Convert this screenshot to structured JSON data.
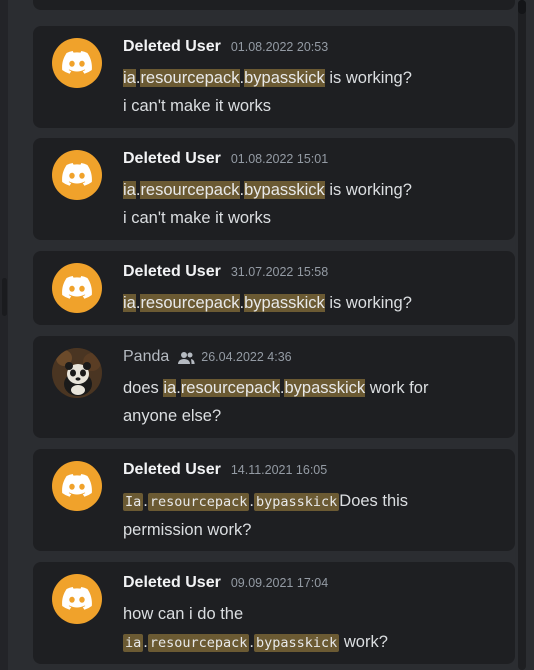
{
  "messages": [
    {
      "author": "Deleted User",
      "timestamp": "01.08.2022 20:53",
      "line1": {
        "p1": "ia",
        "p2": "resourcepack",
        "p3": "bypasskick",
        "rest": " is working?"
      },
      "line2": "i can't make it works"
    },
    {
      "author": "Deleted User",
      "timestamp": "01.08.2022 15:01",
      "line1": {
        "p1": "ia",
        "p2": "resourcepack",
        "p3": "bypasskick",
        "rest": " is working?"
      },
      "line2": "i can't make it works"
    },
    {
      "author": "Deleted User",
      "timestamp": "31.07.2022 15:58",
      "line1": {
        "p1": "ia",
        "p2": "resourcepack",
        "p3": "bypasskick",
        "rest": " is working?"
      }
    },
    {
      "author": "Panda",
      "timestamp": "26.04.2022 4:36",
      "line1": {
        "pre": "does ",
        "p1": "ia",
        "p2": "resourcepack",
        "p3": "bypasskick",
        "rest": " work for"
      },
      "line2": "anyone else?"
    },
    {
      "author": "Deleted User",
      "timestamp": "14.11.2021 16:05",
      "line1": {
        "p1": "Ia",
        "p2": "resourcepack",
        "p3": "bypasskick",
        "rest": "Does this"
      },
      "line2": "permission work?"
    },
    {
      "author": "Deleted User",
      "timestamp": "09.09.2021 17:04",
      "line1": "how can i do the",
      "line2": {
        "p1": "ia",
        "p2": "resourcepack",
        "p3": "bypasskick",
        "rest": " work?"
      }
    }
  ]
}
